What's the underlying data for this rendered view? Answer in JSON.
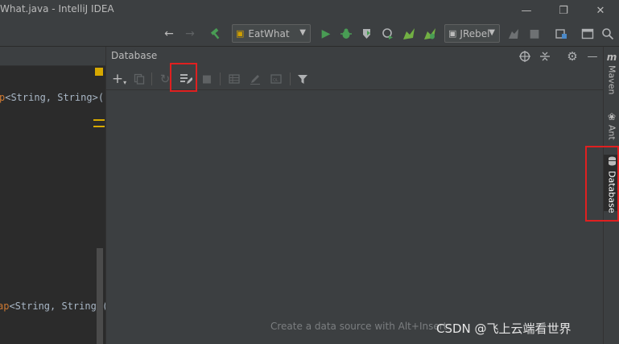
{
  "window": {
    "title": "What.java - IntelliJ IDEA",
    "minimize_icon": "minimize-icon",
    "restore_icon": "restore-icon",
    "close_icon": "close-icon"
  },
  "toolbar": {
    "run_config": "EatWhat",
    "jrebel_config": "JRebel",
    "icons": [
      "back-arrow-icon",
      "forward-arrow-icon",
      "build-hammer-icon",
      "run-icon",
      "debug-icon",
      "coverage-icon",
      "profile-icon",
      "jrebel-run-icon",
      "jrebel-debug-icon",
      "stop-icon",
      "project-structure-icon",
      "layout-icon",
      "search-everywhere-icon"
    ]
  },
  "editor": {
    "lines": [
      {
        "prefix": "p",
        "text": "<String, String>()"
      },
      {
        "prefix": "ap",
        "text": "<String, String>("
      }
    ]
  },
  "database": {
    "title": "Database",
    "empty_hint": "Create a data source with Alt+Insert",
    "header_icons": [
      "target-icon",
      "collapse-icon",
      "settings-gear-icon",
      "hide-icon"
    ],
    "toolbar_icons": [
      "add-icon",
      "copy-icon",
      "refresh-icon",
      "data-source-properties-icon",
      "stop-icon",
      "table-icon",
      "edit-icon",
      "console-icon",
      "filter-icon"
    ]
  },
  "right_strip": {
    "tabs": [
      {
        "label": "Maven",
        "icon": "maven-icon"
      },
      {
        "label": "Ant",
        "icon": "ant-icon"
      },
      {
        "label": "Database",
        "icon": "database-icon"
      }
    ]
  },
  "watermark": "CSDN @飞上云端看世界",
  "colors": {
    "background": "#2b2b2b",
    "panel": "#3c3f41",
    "highlight": "#e02020",
    "run_green": "#499c54",
    "gutter_yellow": "#d7a900"
  }
}
